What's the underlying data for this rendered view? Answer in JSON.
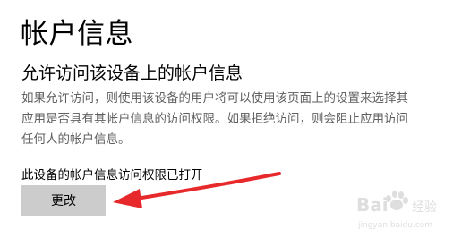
{
  "page": {
    "title": "帐户信息"
  },
  "section": {
    "title": "允许访问该设备上的帐户信息",
    "description": "如果允许访问，则使用该设备的用户将可以使用该页面上的设置来选择其应用是否具有其帐户信息的访问权限。如果拒绝访问，则会阻止应用访问任何人的帐户信息。",
    "status": "此设备的帐户信息访问权限已打开",
    "change_button_label": "更改"
  },
  "annotation": {
    "arrow_color": "#e8292b",
    "arrow_icon": "arrow-pointing-to-button"
  },
  "watermark": {
    "text": "Baidu经验",
    "url_text": "jingyan.baidu.com",
    "icon": "baidu-paw-icon"
  }
}
